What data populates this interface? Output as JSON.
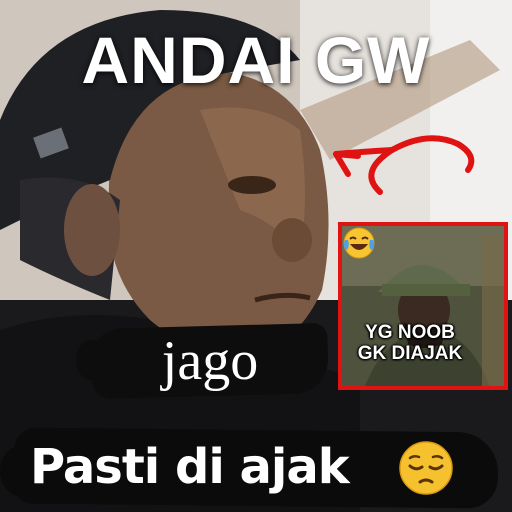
{
  "meme": {
    "top_caption": "ANDAI GW",
    "middle_caption": "jago",
    "bottom_caption": "Pasti di ajak",
    "inset": {
      "caption_line1": "YG NOOB",
      "caption_line2": "GK DIAJAK",
      "border_color": "#e01313"
    },
    "arrow_color": "#e01313",
    "icons": [
      "pensive-face-emoji-icon",
      "laughing-tears-emoji-icon",
      "curved-arrow-icon"
    ]
  }
}
